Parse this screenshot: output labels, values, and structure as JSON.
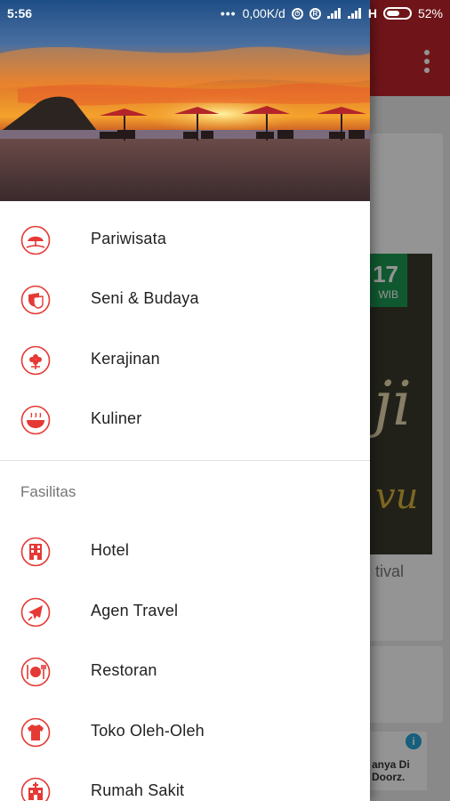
{
  "status_bar": {
    "time": "5:56",
    "data_rate": "0,00K/d",
    "network": "H",
    "battery": "52%"
  },
  "background_app": {
    "poster_badge_number": "17",
    "poster_badge_sub": "WIB",
    "poster_script": "ji",
    "poster_script2": "vu",
    "card_caption": "tival",
    "ad_text": "anya Di\nDoorz."
  },
  "drawer": {
    "main_items": [
      {
        "label": "Pariwisata",
        "icon": "beach-umbrella-icon"
      },
      {
        "label": "Seni & Budaya",
        "icon": "theater-mask-icon"
      },
      {
        "label": "Kerajinan",
        "icon": "flower-craft-icon"
      },
      {
        "label": "Kuliner",
        "icon": "food-bowl-icon"
      }
    ],
    "section_title": "Fasilitas",
    "facility_items": [
      {
        "label": "Hotel",
        "icon": "hotel-icon"
      },
      {
        "label": "Agen Travel",
        "icon": "airplane-icon"
      },
      {
        "label": "Restoran",
        "icon": "plate-cutlery-icon"
      },
      {
        "label": "Toko Oleh-Oleh",
        "icon": "shirt-icon"
      },
      {
        "label": "Rumah Sakit",
        "icon": "hospital-icon"
      }
    ]
  },
  "colors": {
    "accent": "#e53935",
    "app_bar": "#c0252b"
  }
}
